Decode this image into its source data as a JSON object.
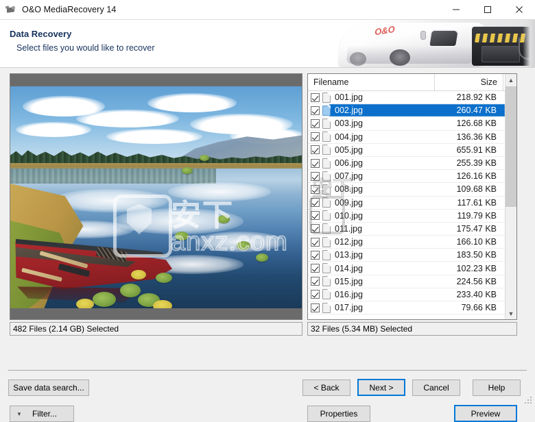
{
  "window": {
    "title": "O&O MediaRecovery 14",
    "icon": "camera-icon",
    "minimize_label": "Minimize",
    "maximize_label": "Maximize",
    "close_label": "Close"
  },
  "header": {
    "title": "Data Recovery",
    "subtitle": "Select files you would like to recover",
    "banner_alt": "white-delivery-van-graphic"
  },
  "preview": {
    "image_alt": "red-canoe-on-lake-with-clouds-reflection",
    "watermark_cn": "安下",
    "watermark_text": "anxz.com"
  },
  "left_status": {
    "text": "482 Files (2.14 GB) Selected"
  },
  "right_status": {
    "text": "32 Files (5.34 MB) Selected"
  },
  "filter_button": {
    "label": "Filter...",
    "caret": "chevron-down-icon"
  },
  "properties_button": {
    "label": "Properties"
  },
  "preview_button": {
    "label": "Preview",
    "focused": true
  },
  "file_list": {
    "columns": [
      "Filename",
      "Size"
    ],
    "scrollbar": {
      "up_arrow": "chevron-up-icon",
      "down_arrow": "chevron-down-icon"
    },
    "rows": [
      {
        "checked": true,
        "name": "001.jpg",
        "size": "218.92 KB",
        "selected": false
      },
      {
        "checked": true,
        "name": "002.jpg",
        "size": "260.47 KB",
        "selected": true
      },
      {
        "checked": true,
        "name": "003.jpg",
        "size": "126.68 KB",
        "selected": false
      },
      {
        "checked": true,
        "name": "004.jpg",
        "size": "136.36 KB",
        "selected": false
      },
      {
        "checked": true,
        "name": "005.jpg",
        "size": "655.91 KB",
        "selected": false
      },
      {
        "checked": true,
        "name": "006.jpg",
        "size": "255.39 KB",
        "selected": false
      },
      {
        "checked": true,
        "name": "007.jpg",
        "size": "126.16 KB",
        "selected": false
      },
      {
        "checked": true,
        "name": "008.jpg",
        "size": "109.68 KB",
        "selected": false
      },
      {
        "checked": true,
        "name": "009.jpg",
        "size": "117.61 KB",
        "selected": false
      },
      {
        "checked": true,
        "name": "010.jpg",
        "size": "119.79 KB",
        "selected": false
      },
      {
        "checked": true,
        "name": "011.jpg",
        "size": "175.47 KB",
        "selected": false
      },
      {
        "checked": true,
        "name": "012.jpg",
        "size": "166.10 KB",
        "selected": false
      },
      {
        "checked": true,
        "name": "013.jpg",
        "size": "183.50 KB",
        "selected": false
      },
      {
        "checked": true,
        "name": "014.jpg",
        "size": "102.23 KB",
        "selected": false
      },
      {
        "checked": true,
        "name": "015.jpg",
        "size": "224.56 KB",
        "selected": false
      },
      {
        "checked": true,
        "name": "016.jpg",
        "size": "233.40 KB",
        "selected": false
      },
      {
        "checked": true,
        "name": "017.jpg",
        "size": "79.66 KB",
        "selected": false
      }
    ]
  },
  "footer": {
    "save_search_label": "Save data search...",
    "back_label": "< Back",
    "next_label": "Next >",
    "cancel_label": "Cancel",
    "help_label": "Help",
    "next_focused": true
  },
  "colors": {
    "accent": "#0078d7",
    "selection": "#0b6fcb",
    "header_text": "#16325c",
    "window_bg": "#f0f0f0",
    "list_bg": "#ffffff"
  }
}
